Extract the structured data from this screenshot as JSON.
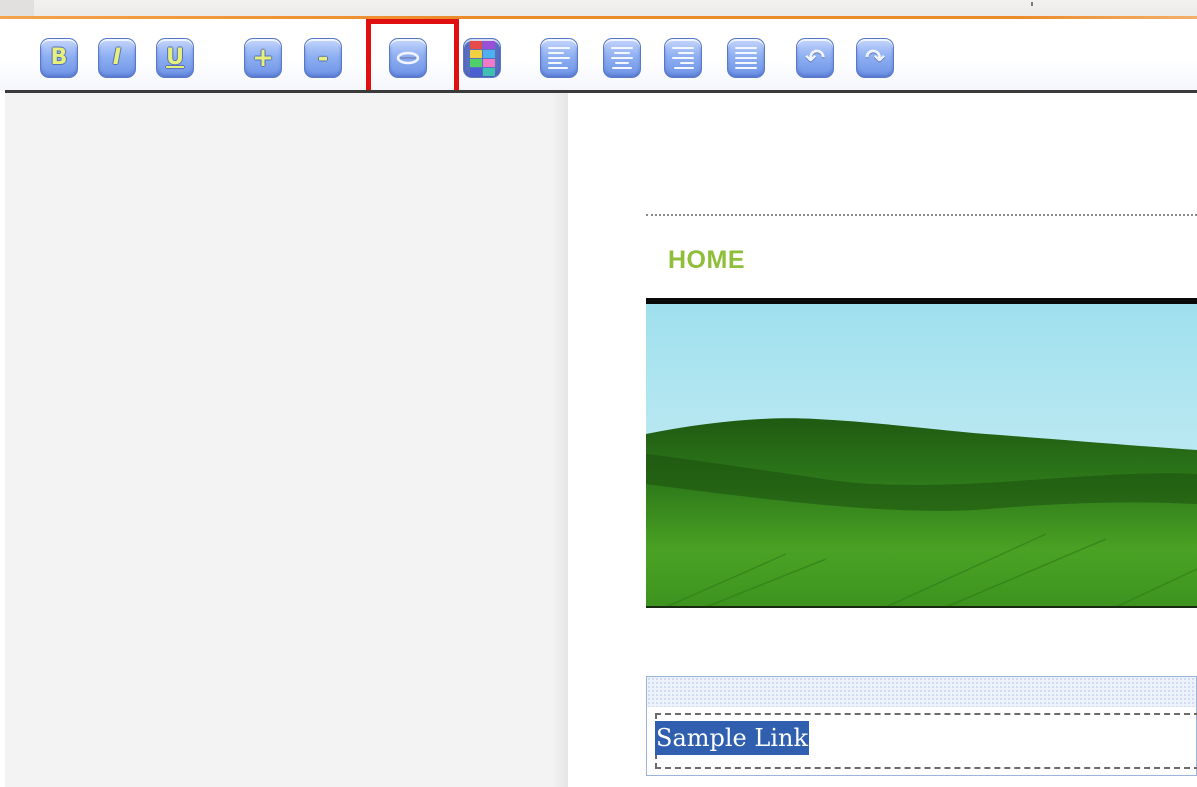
{
  "toolbar": {
    "buttons": [
      {
        "label": "B"
      },
      {
        "label": "I"
      },
      {
        "label": "U"
      },
      {
        "label": "+"
      },
      {
        "label": "-"
      },
      {
        "label": "⇔"
      },
      {
        "label": ""
      },
      {
        "label": ""
      },
      {
        "label": ""
      },
      {
        "label": ""
      },
      {
        "label": ""
      },
      {
        "label": "↶"
      },
      {
        "label": "↷"
      }
    ]
  },
  "icons": {
    "bold": "bold-icon",
    "italic": "italic-icon",
    "underline": "underline-icon",
    "increase_font": "plus-icon",
    "decrease_font": "minus-icon",
    "link": "link-icon",
    "color": "color-palette-icon",
    "align_left": "align-left-icon",
    "align_center": "align-center-icon",
    "align_right": "align-right-icon",
    "justify": "align-justify-icon",
    "undo": "undo-icon",
    "redo": "redo-icon"
  },
  "colors": {
    "highlight": "#e01010",
    "nav_link": "#8fbe3a",
    "selection": "#2f5fae",
    "accent": "#ec8a2a"
  },
  "canvas": {
    "nav": {
      "home": "HOME"
    },
    "link_text": "Sample Link"
  }
}
